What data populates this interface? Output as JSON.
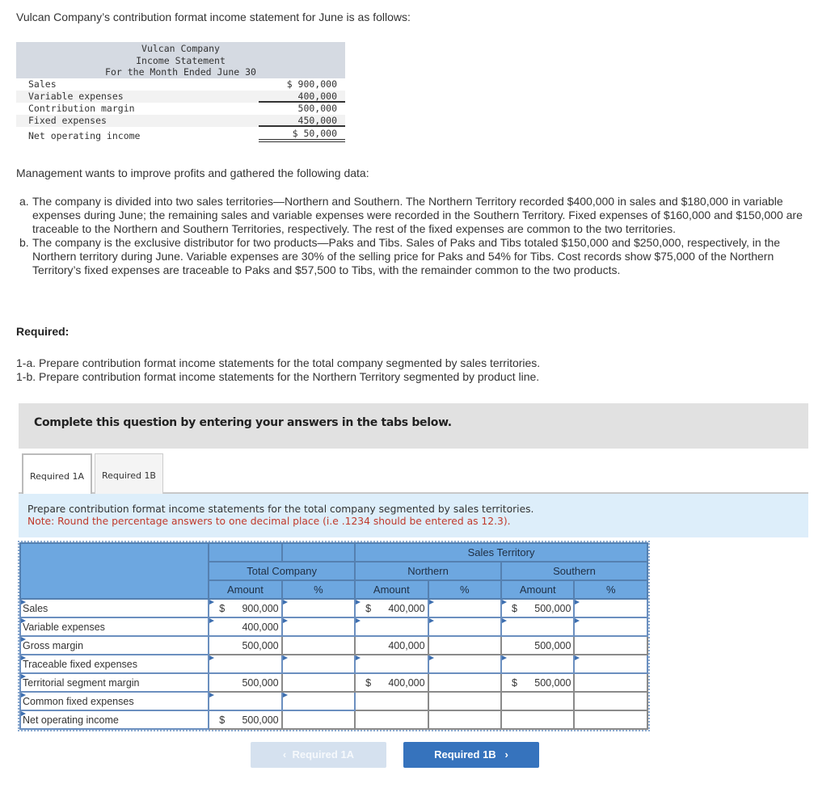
{
  "intro": "Vulcan Company’s contribution format income statement for June is as follows:",
  "mini_statement": {
    "header": [
      "Vulcan Company",
      "Income Statement",
      "For the Month Ended June 30"
    ],
    "rows": [
      {
        "label": "Sales",
        "value": "$ 900,000"
      },
      {
        "label": "Variable expenses",
        "value": "400,000"
      },
      {
        "label": "Contribution margin",
        "value": "500,000"
      },
      {
        "label": "Fixed expenses",
        "value": "450,000"
      },
      {
        "label": "Net operating income",
        "value": "$ 50,000"
      }
    ]
  },
  "management_text": "Management wants to improve profits and gathered the following data:",
  "items": [
    {
      "label": "a.",
      "text": "The company is divided into two sales territories—Northern and Southern. The Northern Territory recorded $400,000 in sales and $180,000 in variable expenses during June; the remaining sales and variable expenses were recorded in the Southern Territory. Fixed expenses of $160,000 and $150,000 are traceable to the Northern and Southern Territories, respectively. The rest of the fixed expenses are common to the two territories."
    },
    {
      "label": "b.",
      "text": "The company is the exclusive distributor for two products—Paks and Tibs. Sales of Paks and Tibs totaled $150,000 and $250,000, respectively, in the Northern territory during June. Variable expenses are 30% of the selling price for Paks and 54% for Tibs. Cost records show $75,000 of the Northern Territory’s fixed expenses are traceable to Paks and $57,500 to Tibs, with the remainder common to the two products."
    }
  ],
  "required_heading": "Required:",
  "requirements": [
    "1-a. Prepare contribution format income statements for the total company segmented by sales territories.",
    "1-b. Prepare contribution format income statements for the Northern Territory segmented by product line."
  ],
  "banner": "Complete this question by entering your answers in the tabs below.",
  "tabs": [
    {
      "label": "Required 1A",
      "active": true
    },
    {
      "label": "Required 1B",
      "active": false
    }
  ],
  "instruction": "Prepare contribution format income statements for the total company segmented by sales territories.",
  "note": "Note: Round the percentage answers to one decimal place (i.e .1234 should be entered as 12.3).",
  "table": {
    "group_header": "Sales Territory",
    "columns": {
      "total": "Total Company",
      "northern": "Northern",
      "southern": "Southern",
      "amount": "Amount",
      "percent": "%"
    },
    "rows": [
      {
        "label": "Sales",
        "total_amt": "900,000",
        "total_dollar": "$",
        "total_pct": "",
        "north_amt": "400,000",
        "north_dollar": "$",
        "north_pct": "",
        "south_amt": "500,000",
        "south_dollar": "$",
        "south_pct": ""
      },
      {
        "label": "Variable expenses",
        "total_amt": "400,000",
        "total_dollar": "",
        "total_pct": "",
        "north_amt": "",
        "north_dollar": "",
        "north_pct": "",
        "south_amt": "",
        "south_dollar": "",
        "south_pct": ""
      },
      {
        "label": "Gross margin",
        "total_amt": "500,000",
        "total_dollar": "",
        "total_pct": "",
        "north_amt": "400,000",
        "north_dollar": "",
        "north_pct": "",
        "south_amt": "500,000",
        "south_dollar": "",
        "south_pct": ""
      },
      {
        "label": "Traceable fixed expenses",
        "total_amt": "",
        "total_dollar": "",
        "total_pct": "",
        "north_amt": "",
        "north_dollar": "",
        "north_pct": "",
        "south_amt": "",
        "south_dollar": "",
        "south_pct": ""
      },
      {
        "label": "Territorial segment margin",
        "total_amt": "500,000",
        "total_dollar": "",
        "total_pct": "",
        "north_amt": "400,000",
        "north_dollar": "$",
        "north_pct": "",
        "south_amt": "500,000",
        "south_dollar": "$",
        "south_pct": ""
      },
      {
        "label": "Common fixed expenses",
        "total_amt": "",
        "total_dollar": "",
        "total_pct": "",
        "north_amt": "",
        "north_dollar": "",
        "north_pct": "",
        "south_amt": "",
        "south_dollar": "",
        "south_pct": ""
      },
      {
        "label": "Net operating income",
        "total_amt": "500,000",
        "total_dollar": "$",
        "total_pct": "",
        "north_amt": "",
        "north_dollar": "",
        "north_pct": "",
        "south_amt": "",
        "south_dollar": "",
        "south_pct": ""
      }
    ]
  },
  "nav": {
    "prev_label": "Required 1A",
    "next_label": "Required 1B",
    "prev_icon": "chevron-left-icon",
    "next_icon": "chevron-right-icon"
  }
}
